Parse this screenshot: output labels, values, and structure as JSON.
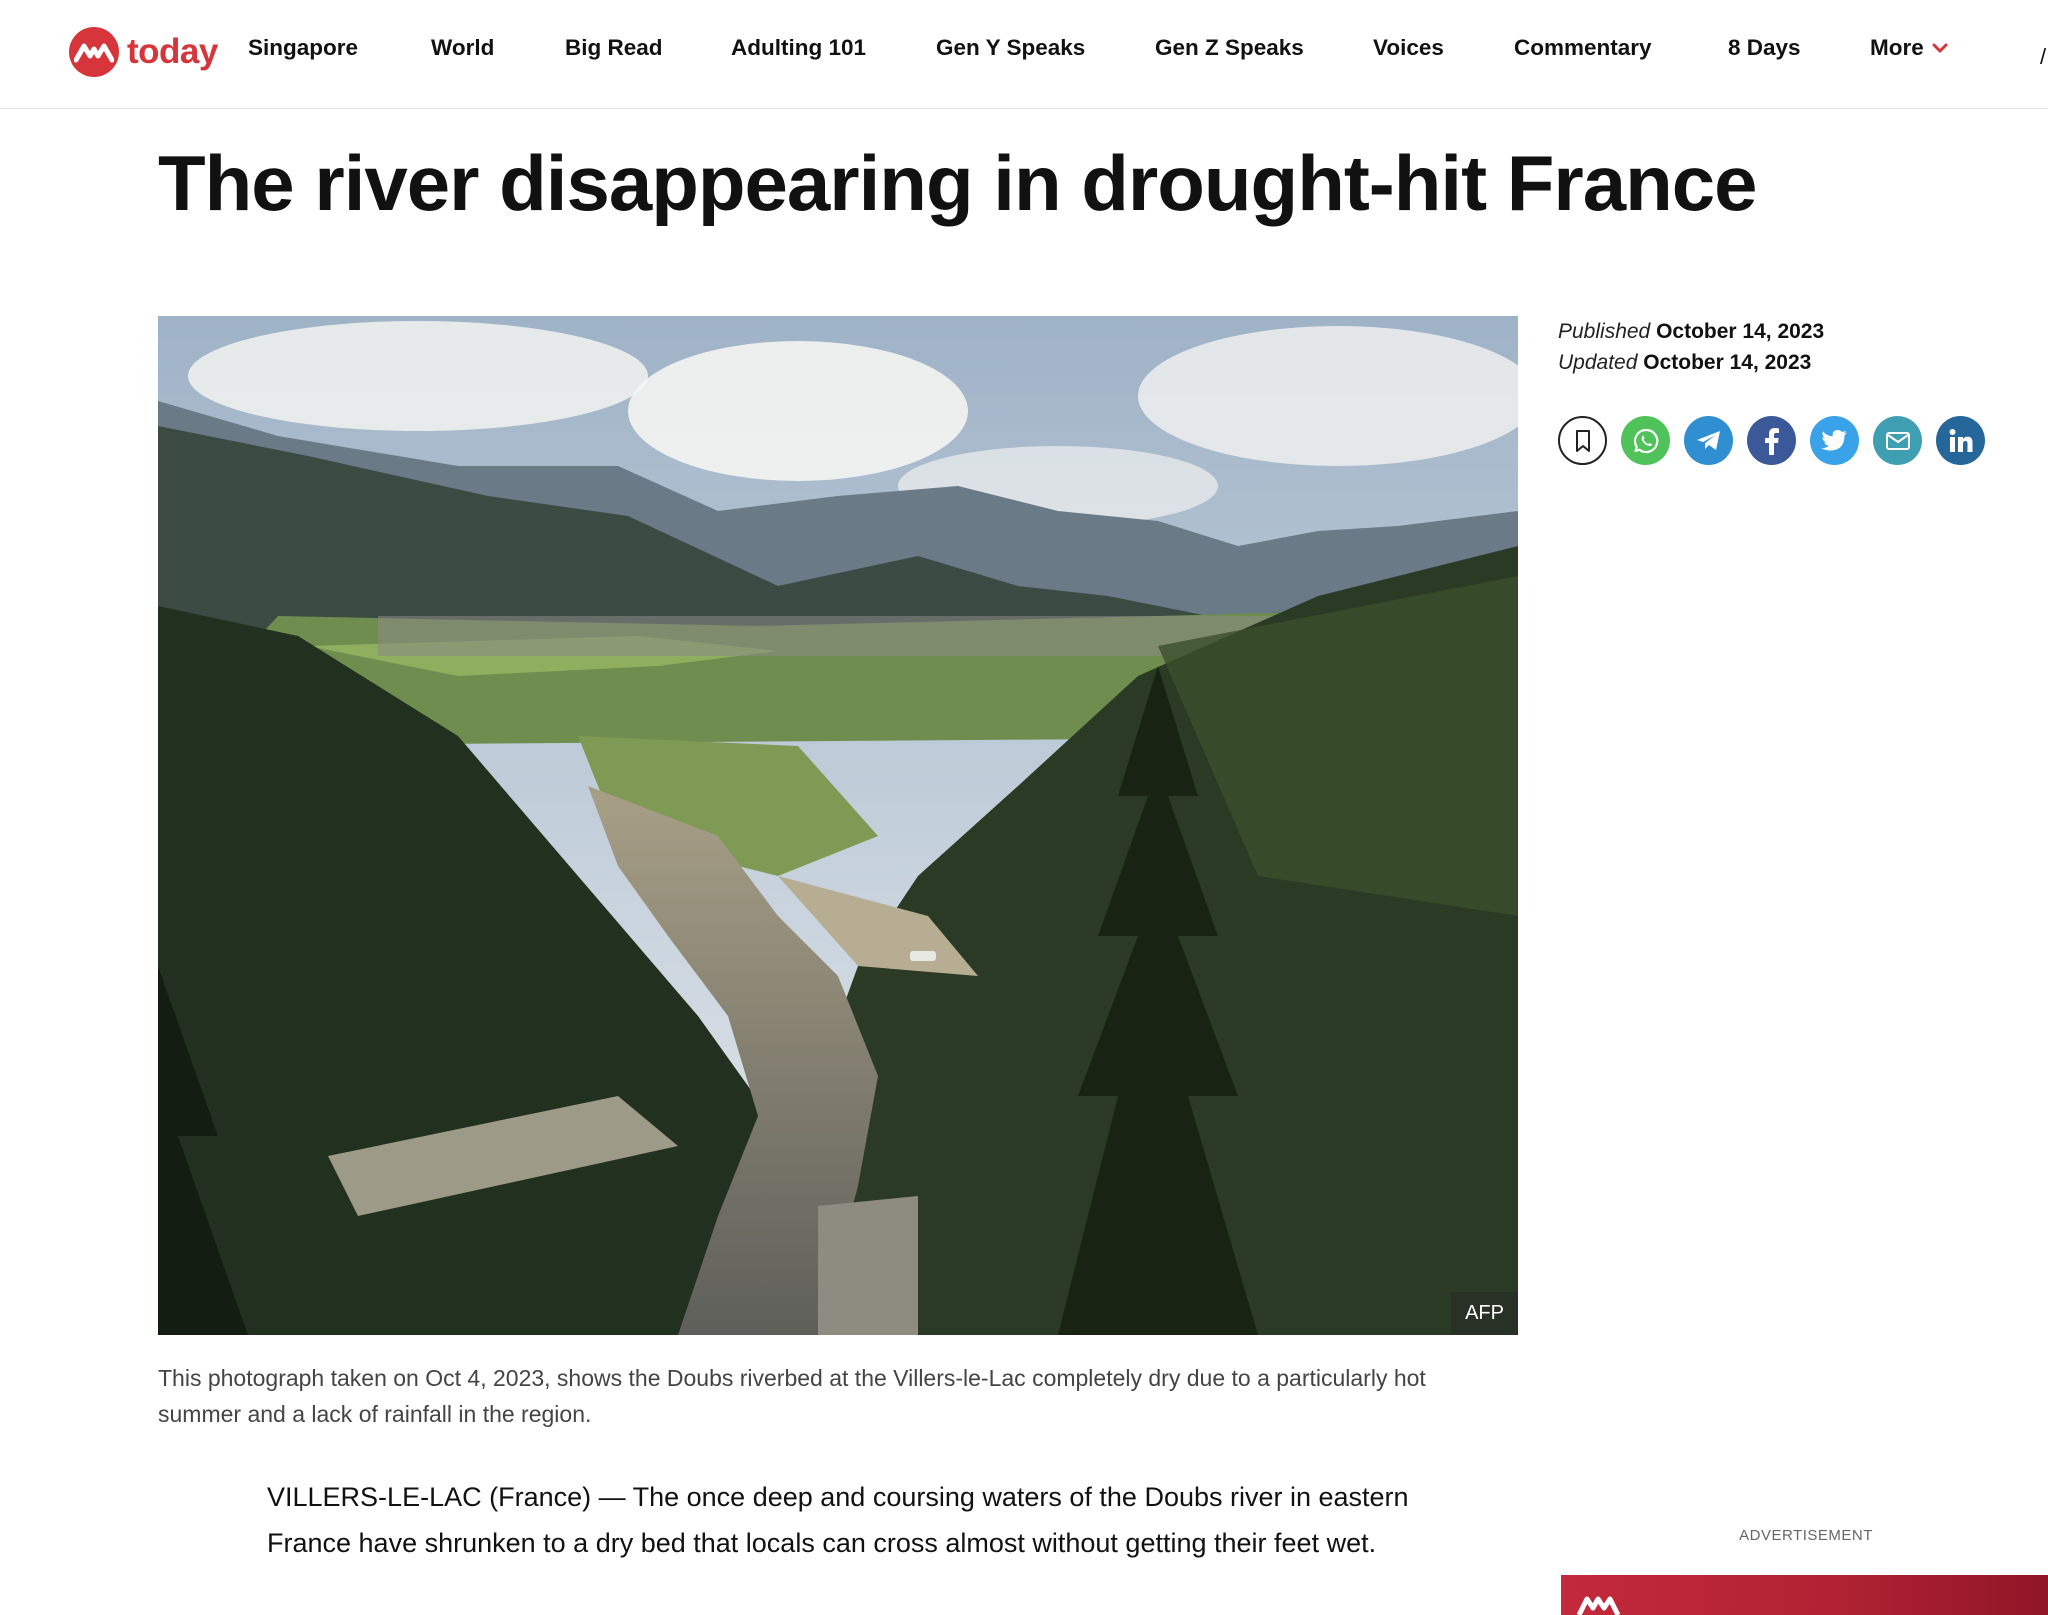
{
  "header": {
    "logo_text": "today",
    "nav": [
      {
        "label": "Singapore"
      },
      {
        "label": "World"
      },
      {
        "label": "Big Read"
      },
      {
        "label": "Adulting 101"
      },
      {
        "label": "Gen Y Speaks"
      },
      {
        "label": "Gen Z Speaks"
      },
      {
        "label": "Voices"
      },
      {
        "label": "Commentary"
      },
      {
        "label": "8 Days"
      }
    ],
    "more_label": "More",
    "accent_color": "#d6363b"
  },
  "article": {
    "headline": "The river disappearing in drought-hit France",
    "photo_credit": "AFP",
    "caption": "This photograph taken on Oct 4, 2023, shows the Doubs riverbed at the Villers-le-Lac completely dry due to a particularly hot summer and a lack of rainfall in the region.",
    "lead_paragraph": "VILLERS-LE-LAC (France) — The once deep and coursing waters of the Doubs river in eastern France have shrunken to a dry bed that locals can cross almost without getting their feet wet."
  },
  "meta": {
    "published_label": "Published",
    "published_date": "October 14, 2023",
    "updated_label": "Updated",
    "updated_date": "October 14, 2023"
  },
  "share": [
    {
      "icon": "bookmark-icon",
      "color": "#ffffff"
    },
    {
      "icon": "whatsapp-icon",
      "color": "#4fc35a"
    },
    {
      "icon": "telegram-icon",
      "color": "#2f8fd0"
    },
    {
      "icon": "facebook-icon",
      "color": "#3b5998"
    },
    {
      "icon": "twitter-icon",
      "color": "#3aa2e9"
    },
    {
      "icon": "email-icon",
      "color": "#3d9fb1"
    },
    {
      "icon": "linkedin-icon",
      "color": "#25669b"
    }
  ],
  "sidebar": {
    "ad_label": "ADVERTISEMENT"
  }
}
